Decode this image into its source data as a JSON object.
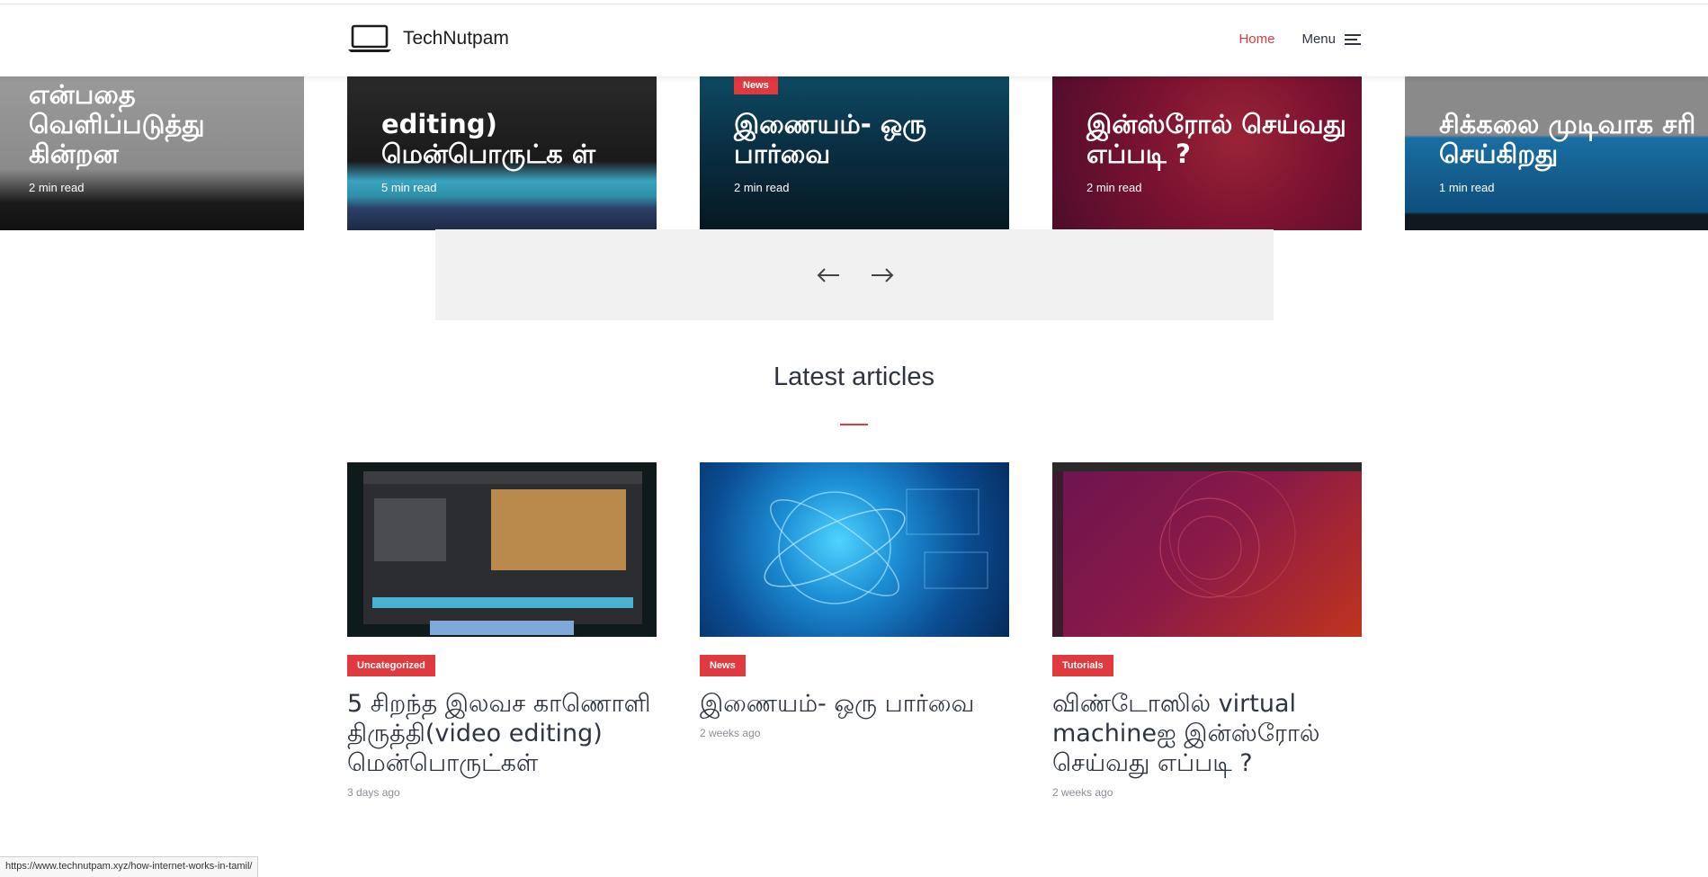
{
  "header": {
    "site_name": "TechNutpam",
    "nav_home": "Home",
    "nav_menu": "Menu"
  },
  "carousel": {
    "slides": [
      {
        "title": "என்பதை வெளிப்படுத்து கின்றன",
        "meta": "2 min read"
      },
      {
        "title": "editing) மென்பொருட்க ள்",
        "meta": "5 min read"
      },
      {
        "title": "இணையம்- ஒரு பார்வை",
        "meta": "2 min read",
        "badge": "News"
      },
      {
        "title": "இன்ஸ்ரோல் செய்வது எப்படி ?",
        "meta": "2 min read"
      },
      {
        "title": "சிக்கலை முடிவாக சரி செய்கிறது",
        "meta": "1 min read"
      }
    ],
    "prev_label": "previous",
    "next_label": "next"
  },
  "section": {
    "title": "Latest articles"
  },
  "articles": [
    {
      "category": "Uncategorized",
      "title": "5 சிறந்த இலவச காணொளி திருத்தி(video editing) மென்பொருட்கள்",
      "meta": "3 days ago"
    },
    {
      "category": "News",
      "title": "இணையம்- ஒரு பார்வை",
      "meta": "2 weeks ago"
    },
    {
      "category": "Tutorials",
      "title": "விண்டோஸில் virtual machineஐ இன்ஸ்ரோல் செய்வது எப்படி ?",
      "meta": "2 weeks ago"
    }
  ],
  "statusbar": {
    "url": "https://www.technutpam.xyz/how-internet-works-in-tamil/"
  },
  "colors": {
    "accent": "#e0393e",
    "text": "#2f3540",
    "muted": "#8a8f96"
  }
}
